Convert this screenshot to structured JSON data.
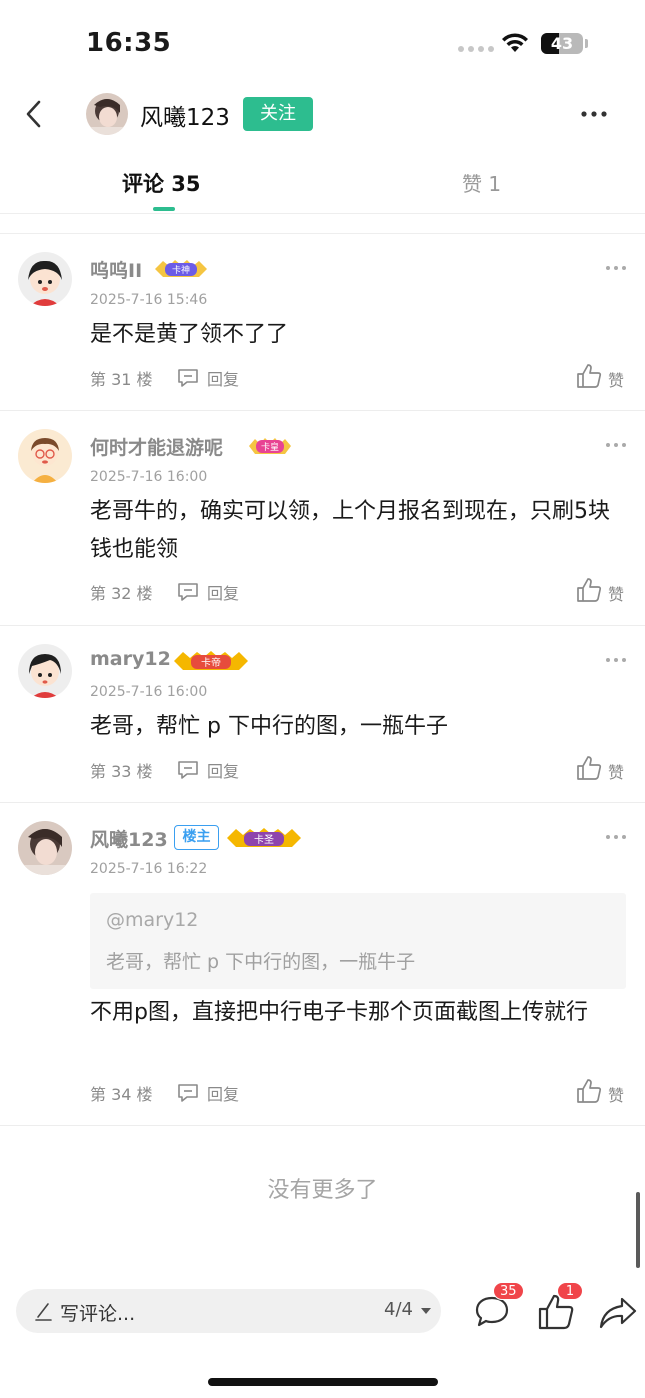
{
  "status_bar": {
    "time": "16:35",
    "battery": "43"
  },
  "header": {
    "username": "风曦123",
    "follow_label": "关注"
  },
  "tabs": {
    "comments": "评论 35",
    "likes": "赞 1"
  },
  "comments": [
    {
      "username": "呜呜II",
      "badge": "卡神",
      "time": "2025-7-16 15:46",
      "text": "是不是黄了领不了了",
      "floor": "第 31 楼",
      "reply_label": "回复",
      "like_label": "赞"
    },
    {
      "username": "何时才能退游呢",
      "badge": "卡皇",
      "time": "2025-7-16 16:00",
      "text": "老哥牛的，确实可以领，上个月报名到现在，只刷5块钱也能领",
      "floor": "第 32 楼",
      "reply_label": "回复",
      "like_label": "赞"
    },
    {
      "username": "mary12",
      "badge": "卡帝",
      "time": "2025-7-16 16:00",
      "text": "老哥，帮忙 p 下中行的图，一瓶牛子",
      "floor": "第 33 楼",
      "reply_label": "回复",
      "like_label": "赞"
    },
    {
      "username": "风曦123",
      "owner_label": "楼主",
      "badge": "卡圣",
      "time": "2025-7-16 16:22",
      "quote_user": "@mary12",
      "quote_text": "老哥，帮忙 p 下中行的图，一瓶牛子",
      "text": "不用p图，直接把中行电子卡那个页面截图上传就行",
      "floor": "第 34 楼",
      "reply_label": "回复",
      "like_label": "赞"
    }
  ],
  "footer_text": "没有更多了",
  "bottom_bar": {
    "placeholder": "写评论...",
    "page": "4/4",
    "comment_count": "35",
    "like_count": "1"
  },
  "colors": {
    "accent": "#2dbd8f",
    "badge_red": "#f0454a",
    "owner_blue": "#3a9ff0"
  },
  "battery_level": 0.43
}
